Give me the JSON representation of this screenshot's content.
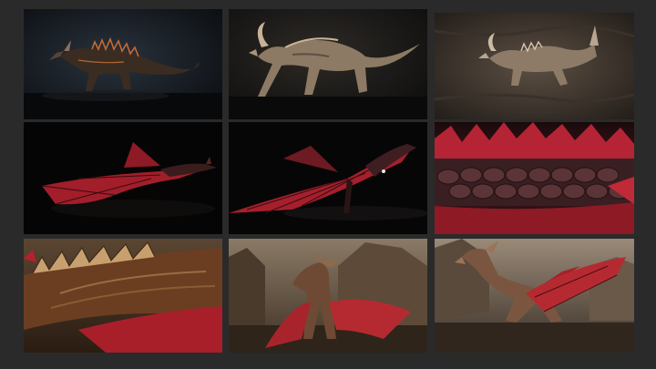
{
  "gallery": {
    "background": "#2a2a2a",
    "tiles": [
      {
        "subject": "bone-dragon-side-view",
        "palette": [
          "#0f1318",
          "#1d232b",
          "#a85a2e"
        ]
      },
      {
        "subject": "stone-dragon-walking",
        "palette": [
          "#111111",
          "#2b2723",
          "#b9a58a"
        ]
      },
      {
        "subject": "dragon-on-rock-wall",
        "palette": [
          "#2b2520",
          "#5a4c40",
          "#c7b59f"
        ]
      },
      {
        "subject": "red-winged-dragon-dark",
        "palette": [
          "#050505",
          "#0f0b0b",
          "#b01e2a"
        ]
      },
      {
        "subject": "red-winged-dragon-flying",
        "palette": [
          "#050505",
          "#120d0d",
          "#a3202c"
        ]
      },
      {
        "subject": "dragon-scales-closeup",
        "palette": [
          "#0c0606",
          "#3a1218",
          "#c02a38"
        ]
      },
      {
        "subject": "dragon-spikes-closeup",
        "palette": [
          "#2c1f14",
          "#6b3a1e",
          "#b4222c"
        ]
      },
      {
        "subject": "dragon-front-canyon",
        "palette": [
          "#5a4a3a",
          "#8b7359",
          "#a8242c"
        ]
      },
      {
        "subject": "dragon-roaring-canyon",
        "palette": [
          "#3e362e",
          "#8b7a68",
          "#b52a30"
        ]
      }
    ]
  }
}
